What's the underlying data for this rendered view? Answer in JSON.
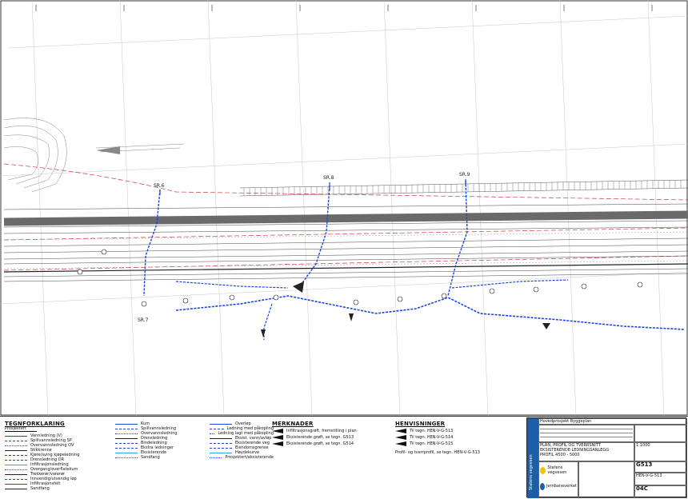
{
  "plan": {
    "section_labels": [
      "SR.6",
      "SR.8",
      "SR.9",
      "SR.7"
    ],
    "pipe_color": "#1b47e0",
    "road_color": "#555555",
    "border_color": "#d23a3a"
  },
  "legend": {
    "tegnforklaring": {
      "heading": "TEGNFORKLARING",
      "subheading": "Prosjektert",
      "items": [
        "Vannledning (V)",
        "Spillvannsledning SP",
        "Overvannsledning OV",
        "Stikkrenne",
        "Kjøre/sving kjøpeledning",
        "Drensledning DR",
        "Infiltrasjonsledning",
        "Overgang/overflatekum",
        "Trekkerør/varerør",
        "Innvendig/utvendig løp",
        "Infiltrasjonsfelt",
        "Sandfang"
      ]
    },
    "symbols": {
      "items": [
        "Kum",
        "Spillvannsledning",
        "Overvannsledning",
        "Drensledning",
        "Bindeledning",
        "Ekstra ledninger",
        "Eksisterende",
        "Sandfang"
      ]
    },
    "misc": {
      "items": [
        "Overløp",
        "Ledning med påkopling",
        "Ledning lagt med påkopling",
        "Eksist. vann/avløp",
        "Eksisterende veg",
        "Eiendomsgrense",
        "Høydekurve",
        "Prosjektert/eksisterende"
      ]
    },
    "merknader": {
      "heading": "MERKNADER",
      "items": [
        "Infiltrasjonsgrøft, fremstilling i plan",
        "Eksisterende grøft, se tegn. G513",
        "Eksisterende grøft, se tegn. G514"
      ]
    },
    "henvisninger": {
      "heading": "HENVISNINGER",
      "items": [
        "Til tegn. HEN-V-G-513",
        "Til tegn. HEN-V-G-514",
        "Til tegn. HEN-V-G-515"
      ],
      "footer": "Profil- og tverrprofil, se tegn. HEN-V-G-513"
    }
  },
  "titleblock": {
    "project_line": "Hovedprosjekt Byggeplan",
    "drawing_title_1": "PLAN, PROFIL OG TVERRSNITT",
    "drawing_title_2": "EKSISTERENDE LEDNINGSANLEGG",
    "profile": "PROFIL 4500 - 5000",
    "sheet_no": "G513",
    "drawing_no": "HEN-V-G-513",
    "revision": "04C",
    "client_1": "Statens vegvesen",
    "client_2": "Jernbaneverket",
    "scale": "1:1000"
  }
}
